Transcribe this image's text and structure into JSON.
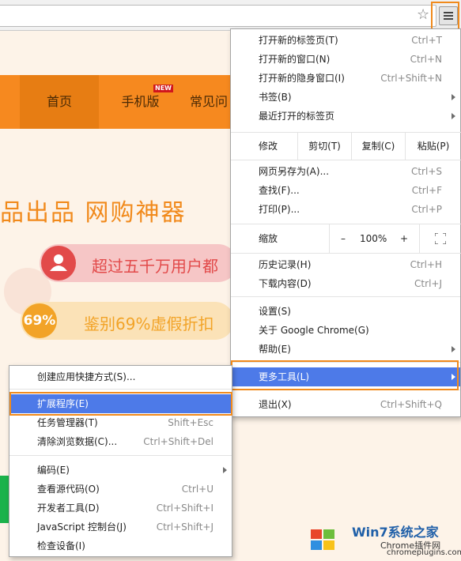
{
  "colors": {
    "orange": "#f6891f",
    "highlight": "#f08a1c",
    "active": "#4d7ae8",
    "green": "#1bb24b"
  },
  "toolbar": {
    "star_icon": "star-icon",
    "menu_icon": "hamburger-menu-icon"
  },
  "page": {
    "nav": {
      "home": "首页",
      "mobile": "手机版",
      "new_badge": "NEW",
      "faq": "常见问"
    },
    "hero": "品出品 网购神器",
    "features": [
      {
        "icon": "user-icon",
        "text": "超过五千万用户都"
      },
      {
        "badge": "69%",
        "text": "鉴别69%虚假折扣"
      }
    ]
  },
  "watermark": {
    "line1": "Win7系统之家",
    "line2": "Chrome插件网",
    "line3": "chromeplugins.com"
  },
  "main_menu": {
    "group1": [
      {
        "label": "打开新的标签页(T)",
        "shortcut": "Ctrl+T"
      },
      {
        "label": "打开新的窗口(N)",
        "shortcut": "Ctrl+N"
      },
      {
        "label": "打开新的隐身窗口(I)",
        "shortcut": "Ctrl+Shift+N"
      },
      {
        "label": "书签(B)",
        "shortcut": ""
      },
      {
        "label": "最近打开的标签页",
        "shortcut": ""
      }
    ],
    "edit": {
      "label": "修改",
      "cut": "剪切(T)",
      "copy": "复制(C)",
      "paste": "粘贴(P)"
    },
    "group2": [
      {
        "label": "网页另存为(A)...",
        "shortcut": "Ctrl+S"
      },
      {
        "label": "查找(F)...",
        "shortcut": "Ctrl+F"
      },
      {
        "label": "打印(P)...",
        "shortcut": "Ctrl+P"
      }
    ],
    "zoom": {
      "label": "缩放",
      "minus": "–",
      "value": "100%",
      "plus": "+"
    },
    "group3": [
      {
        "label": "历史记录(H)",
        "shortcut": "Ctrl+H"
      },
      {
        "label": "下载内容(D)",
        "shortcut": "Ctrl+J"
      }
    ],
    "group4": [
      {
        "label": "设置(S)",
        "shortcut": ""
      },
      {
        "label": "关于 Google Chrome(G)",
        "shortcut": ""
      },
      {
        "label": "帮助(E)",
        "shortcut": ""
      }
    ],
    "more_tools": "更多工具(L)",
    "exit": {
      "label": "退出(X)",
      "shortcut": "Ctrl+Shift+Q"
    }
  },
  "sub_menu": {
    "create_shortcut": "创建应用快捷方式(S)...",
    "extensions": "扩展程序(E)",
    "task_manager": {
      "label": "任务管理器(T)",
      "shortcut": "Shift+Esc"
    },
    "clear_data": {
      "label": "清除浏览数据(C)...",
      "shortcut": "Ctrl+Shift+Del"
    },
    "encoding": "编码(E)",
    "view_source": {
      "label": "查看源代码(O)",
      "shortcut": "Ctrl+U"
    },
    "dev_tools": {
      "label": "开发者工具(D)",
      "shortcut": "Ctrl+Shift+I"
    },
    "js_console": {
      "label": "JavaScript 控制台(J)",
      "shortcut": "Ctrl+Shift+J"
    },
    "inspect": "检查设备(I)"
  }
}
